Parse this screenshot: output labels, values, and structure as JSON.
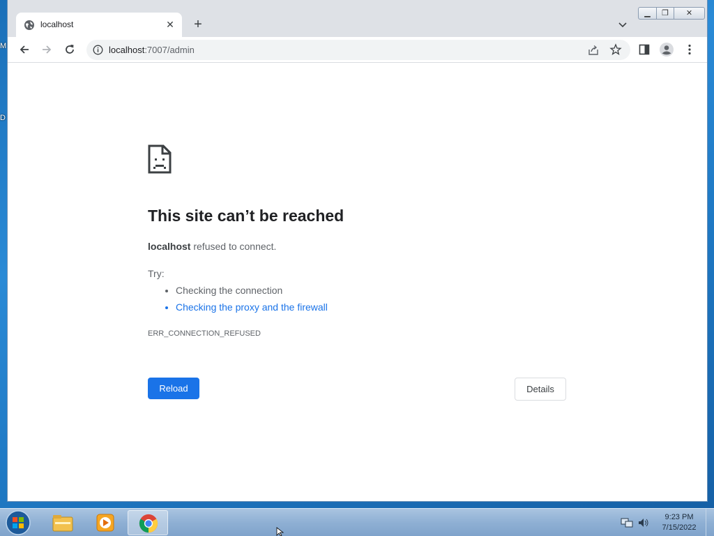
{
  "desktop": {
    "frag_top": "M",
    "frag_mid": "D"
  },
  "browser": {
    "tab": {
      "title": "localhost",
      "icon": "globe-icon"
    },
    "address_bar": {
      "host": "localhost",
      "path": ":7007/admin"
    }
  },
  "page": {
    "title": "This site can’t be reached",
    "host_bold": "localhost",
    "desc_rest": " refused to connect.",
    "try_label": "Try:",
    "suggestions": [
      "Checking the connection",
      "Checking the proxy and the firewall"
    ],
    "error_code": "ERR_CONNECTION_REFUSED",
    "reload_label": "Reload",
    "details_label": "Details"
  },
  "taskbar": {
    "apps": [
      "explorer-icon",
      "media-player-icon",
      "chrome-icon"
    ],
    "clock_time": "9:23 PM",
    "clock_date": "7/15/2022"
  },
  "colors": {
    "accent": "#1a73e8",
    "title_text": "#202124",
    "body_text": "#5f6368"
  }
}
